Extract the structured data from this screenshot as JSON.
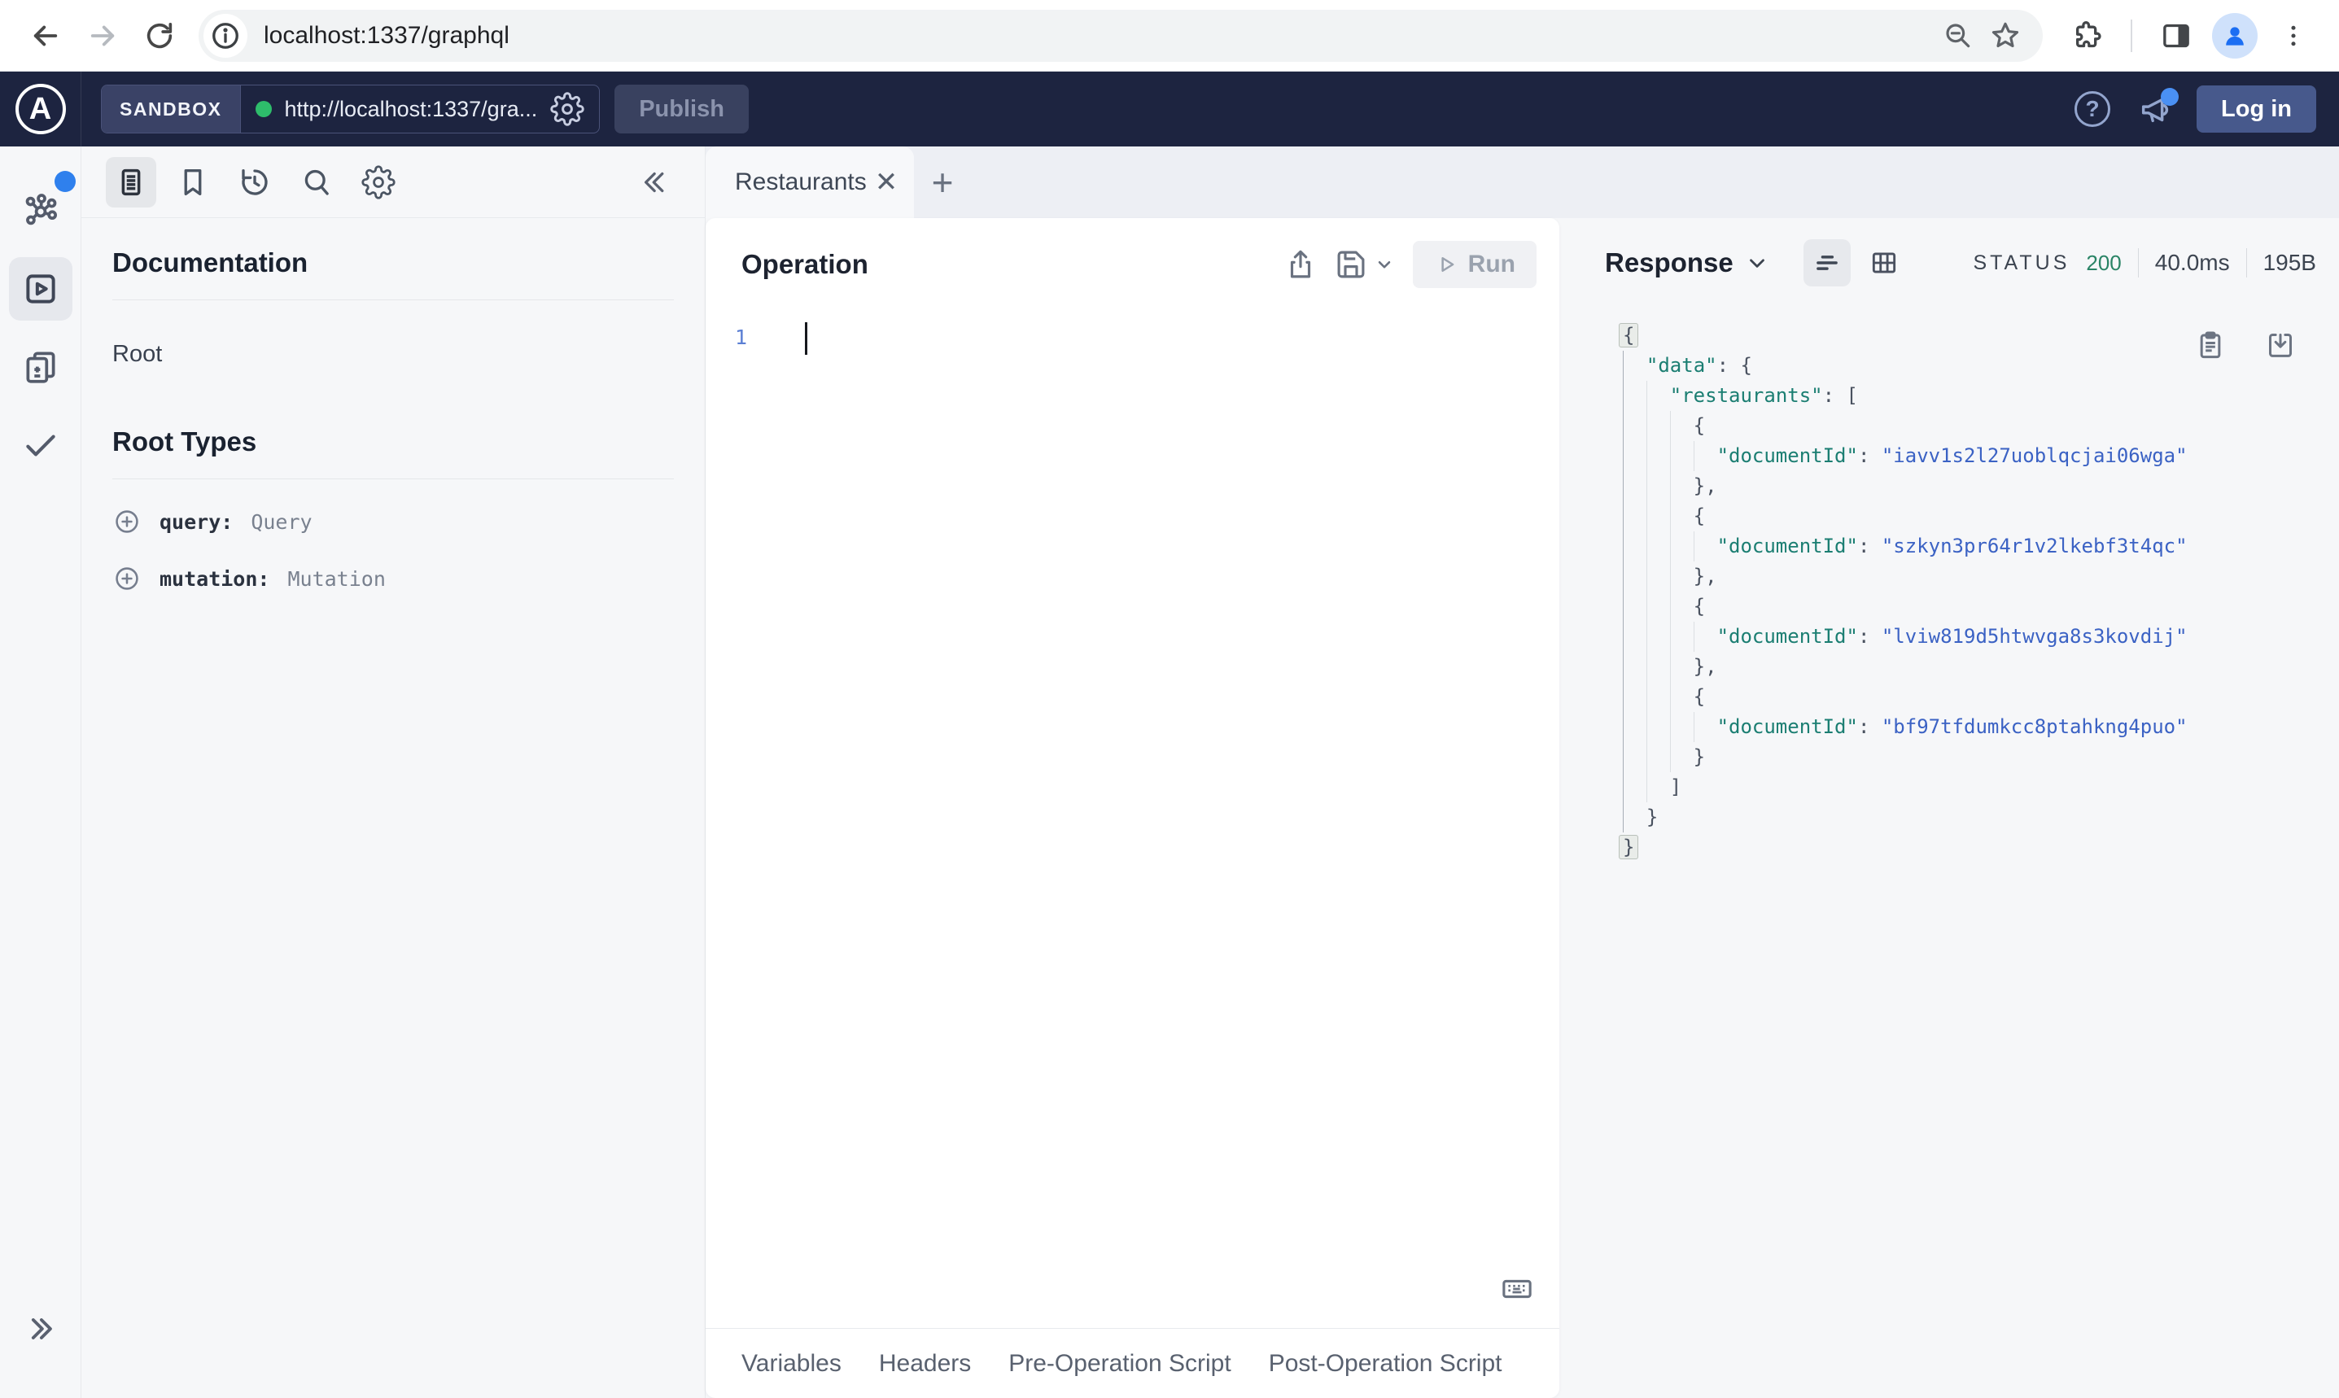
{
  "browser": {
    "url": "localhost:1337/graphql"
  },
  "apollo_header": {
    "logo_letter": "A",
    "env_badge": "SANDBOX",
    "endpoint_url": "http://localhost:1337/gra...",
    "publish_label": "Publish",
    "help_label": "?",
    "login_label": "Log in"
  },
  "rail": {
    "items": [
      {
        "name": "schema",
        "icon": "graph-icon",
        "notification": true
      },
      {
        "name": "explorer",
        "icon": "play-square-icon",
        "selected": true
      },
      {
        "name": "changelog",
        "icon": "diff-docs-icon"
      },
      {
        "name": "checks",
        "icon": "checkmark-icon"
      }
    ]
  },
  "sidebar": {
    "tools": [
      "documentation",
      "bookmarks",
      "history",
      "search",
      "settings"
    ],
    "documentation_title": "Documentation",
    "root_item": "Root",
    "root_types_title": "Root Types",
    "root_types": [
      {
        "field": "query:",
        "type": "Query"
      },
      {
        "field": "mutation:",
        "type": "Mutation"
      }
    ]
  },
  "tabs": {
    "active_label": "Restaurants",
    "new_tab_label": "+"
  },
  "operation": {
    "title": "Operation",
    "run_label": "Run",
    "line_number": "1"
  },
  "response": {
    "title": "Response",
    "status_label": "STATUS",
    "status_code": "200",
    "duration": "40.0ms",
    "size": "195B",
    "lines": [
      {
        "indent": 0,
        "segs": [
          {
            "c": "p hl",
            "t": "{"
          }
        ]
      },
      {
        "indent": 1,
        "segs": [
          {
            "c": "k",
            "t": "\"data\""
          },
          {
            "c": "p",
            "t": ": {"
          }
        ]
      },
      {
        "indent": 2,
        "segs": [
          {
            "c": "k",
            "t": "\"restaurants\""
          },
          {
            "c": "p",
            "t": ": ["
          }
        ]
      },
      {
        "indent": 3,
        "segs": [
          {
            "c": "p",
            "t": "{"
          }
        ]
      },
      {
        "indent": 4,
        "segs": [
          {
            "c": "k",
            "t": "\"documentId\""
          },
          {
            "c": "p",
            "t": ": "
          },
          {
            "c": "s",
            "t": "\"iavv1s2l27uoblqcjai06wga\""
          }
        ]
      },
      {
        "indent": 3,
        "segs": [
          {
            "c": "p",
            "t": "},"
          }
        ]
      },
      {
        "indent": 3,
        "segs": [
          {
            "c": "p",
            "t": "{"
          }
        ]
      },
      {
        "indent": 4,
        "segs": [
          {
            "c": "k",
            "t": "\"documentId\""
          },
          {
            "c": "p",
            "t": ": "
          },
          {
            "c": "s",
            "t": "\"szkyn3pr64r1v2lkebf3t4qc\""
          }
        ]
      },
      {
        "indent": 3,
        "segs": [
          {
            "c": "p",
            "t": "},"
          }
        ]
      },
      {
        "indent": 3,
        "segs": [
          {
            "c": "p",
            "t": "{"
          }
        ]
      },
      {
        "indent": 4,
        "segs": [
          {
            "c": "k",
            "t": "\"documentId\""
          },
          {
            "c": "p",
            "t": ": "
          },
          {
            "c": "s",
            "t": "\"lviw819d5htwvga8s3kovdij\""
          }
        ]
      },
      {
        "indent": 3,
        "segs": [
          {
            "c": "p",
            "t": "},"
          }
        ]
      },
      {
        "indent": 3,
        "segs": [
          {
            "c": "p",
            "t": "{"
          }
        ]
      },
      {
        "indent": 4,
        "segs": [
          {
            "c": "k",
            "t": "\"documentId\""
          },
          {
            "c": "p",
            "t": ": "
          },
          {
            "c": "s",
            "t": "\"bf97tfdumkcc8ptahkng4puo\""
          }
        ]
      },
      {
        "indent": 3,
        "segs": [
          {
            "c": "p",
            "t": "}"
          }
        ]
      },
      {
        "indent": 2,
        "segs": [
          {
            "c": "p",
            "t": "]"
          }
        ]
      },
      {
        "indent": 1,
        "segs": [
          {
            "c": "p",
            "t": "}"
          }
        ]
      },
      {
        "indent": 0,
        "segs": [
          {
            "c": "p hl",
            "t": "}"
          }
        ]
      }
    ]
  },
  "footer": {
    "tabs": [
      "Variables",
      "Headers",
      "Pre-Operation Script",
      "Post-Operation Script"
    ]
  },
  "colors": {
    "header_bg": "#1d2440",
    "notification_blue": "#2f80ed",
    "endpoint_green": "#2ebd6b",
    "status_green": "#2a8466",
    "json_key_teal": "#1b7e72",
    "json_string_blue": "#3b62c4"
  }
}
